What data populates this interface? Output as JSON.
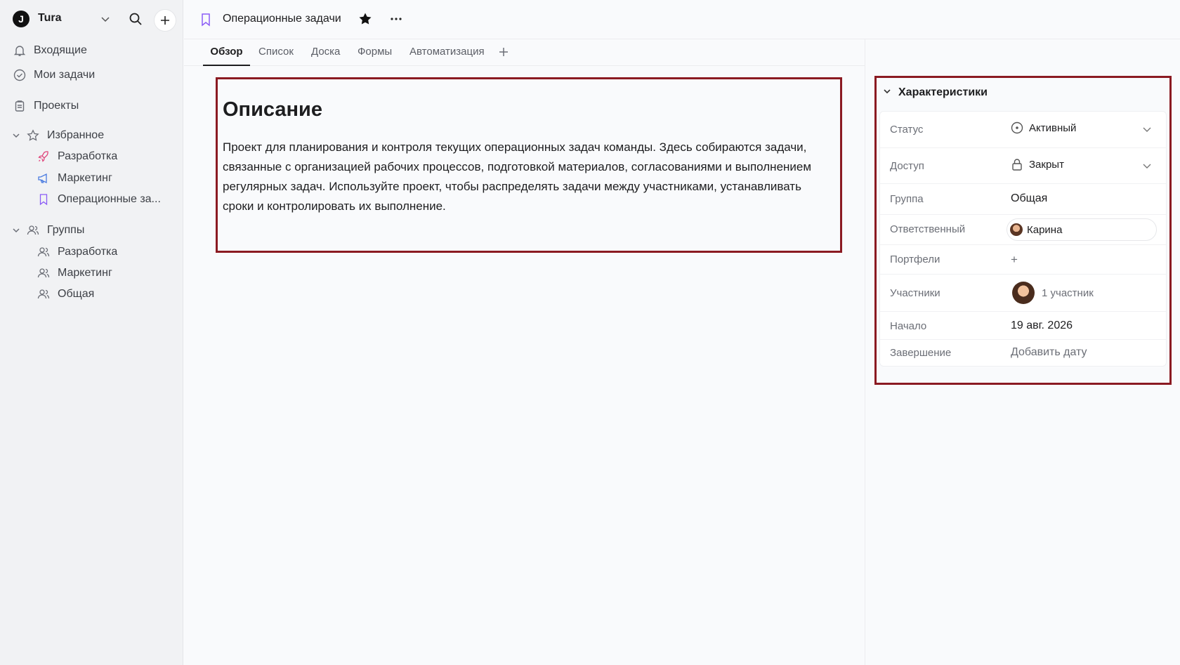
{
  "workspace": {
    "name": "Tura",
    "logo_letter": "J"
  },
  "sidebar": {
    "inbox": "Входящие",
    "my_tasks": "Мои задачи",
    "projects": "Проекты",
    "favorites": {
      "title": "Избранное",
      "items": [
        {
          "label": "Разработка",
          "icon": "rocket-icon",
          "color": "#e0457b"
        },
        {
          "label": "Маркетинг",
          "icon": "megaphone-icon",
          "color": "#4a7be0"
        },
        {
          "label": "Операционные за...",
          "icon": "bookmark-icon",
          "color": "#8b5cf6"
        }
      ]
    },
    "groups": {
      "title": "Группы",
      "items": [
        {
          "label": "Разработка",
          "icon": "group-icon"
        },
        {
          "label": "Маркетинг",
          "icon": "group-icon"
        },
        {
          "label": "Общая",
          "icon": "group-icon"
        }
      ]
    }
  },
  "project": {
    "title": "Операционные задачи",
    "icon_color": "#8b5cf6"
  },
  "tabs": [
    "Обзор",
    "Список",
    "Доска",
    "Формы",
    "Автоматизация"
  ],
  "description": {
    "title": "Описание",
    "text": "Проект для планирования и контроля текущих операционных задач команды. Здесь собираются задачи, связанные с организацией рабочих процессов, подготовкой материалов, согласованиями и выполнением регулярных задач. Используйте проект, чтобы распределять задачи между участниками, устанавливать сроки и контролировать их выполнение."
  },
  "properties": {
    "title": "Характеристики",
    "status": {
      "label": "Статус",
      "value": "Активный"
    },
    "access": {
      "label": "Доступ",
      "value": "Закрыт"
    },
    "group": {
      "label": "Группа",
      "value": "Общая"
    },
    "owner": {
      "label": "Ответственный",
      "value": "Карина"
    },
    "portfolios": {
      "label": "Портфели",
      "value": "+"
    },
    "members": {
      "label": "Участники",
      "value": "1 участник"
    },
    "start": {
      "label": "Начало",
      "value": "19 авг. 2026"
    },
    "end": {
      "label": "Завершение",
      "value": "Добавить дату"
    }
  },
  "colors": {
    "highlight_border": "#8b1a22"
  }
}
